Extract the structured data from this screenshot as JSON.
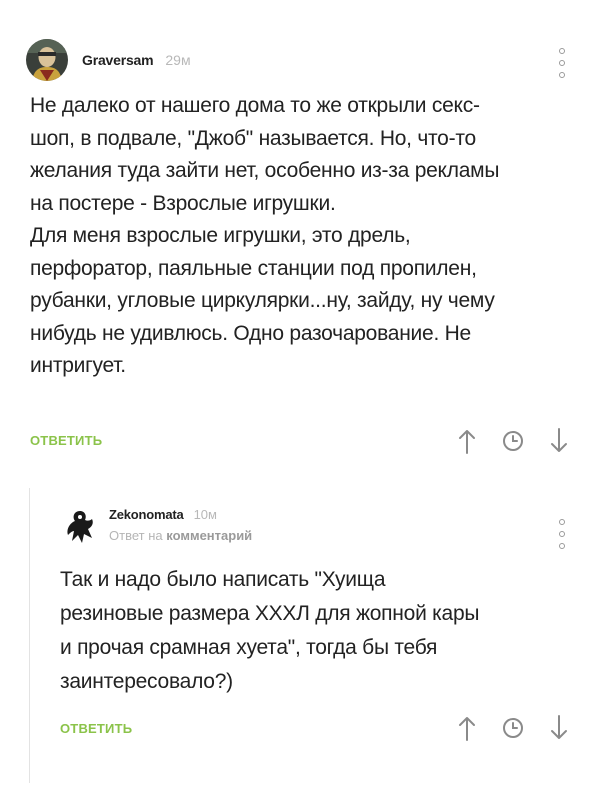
{
  "comment": {
    "author": "Graversam",
    "time": "29м",
    "lines": [
      "Не далеко от нашего дома то же открыли секс-",
      "шоп, в подвале, \"Джоб\" называется. Но, что-то",
      "желания туда зайти нет, особенно из-за рекламы",
      "на постере - Взрослые игрушки.",
      "Для меня взрослые игрушки, это дрель,",
      "перфоратор, паяльные станции под пропилен,",
      "рубанки, угловые циркулярки...ну, зайду, ну чему",
      "нибудь не удивлюсь. Одно разочарование. Не",
      "интригует."
    ],
    "reply_label": "ОТВЕТИТЬ",
    "icons": [
      "more-vertical-icon",
      "arrow-up-icon",
      "clock-icon",
      "arrow-down-icon"
    ]
  },
  "reply": {
    "author": "Zekonomata",
    "time": "10м",
    "reply_prefix": "Ответ на",
    "reply_target": "комментарий",
    "lines": [
      "Так и надо было написать \"Хуища",
      "резиновые размера XXXЛ для жопной кары",
      "и прочая срамная хуета\", тогда бы тебя",
      "заинтересовало?)"
    ],
    "reply_label": "ОТВЕТИТЬ"
  },
  "colors": {
    "accent": "#8bc34a",
    "text": "#222222",
    "muted": "#b8b8b8",
    "icon": "#9a9a9a",
    "thread_line": "#e3e3e3"
  }
}
